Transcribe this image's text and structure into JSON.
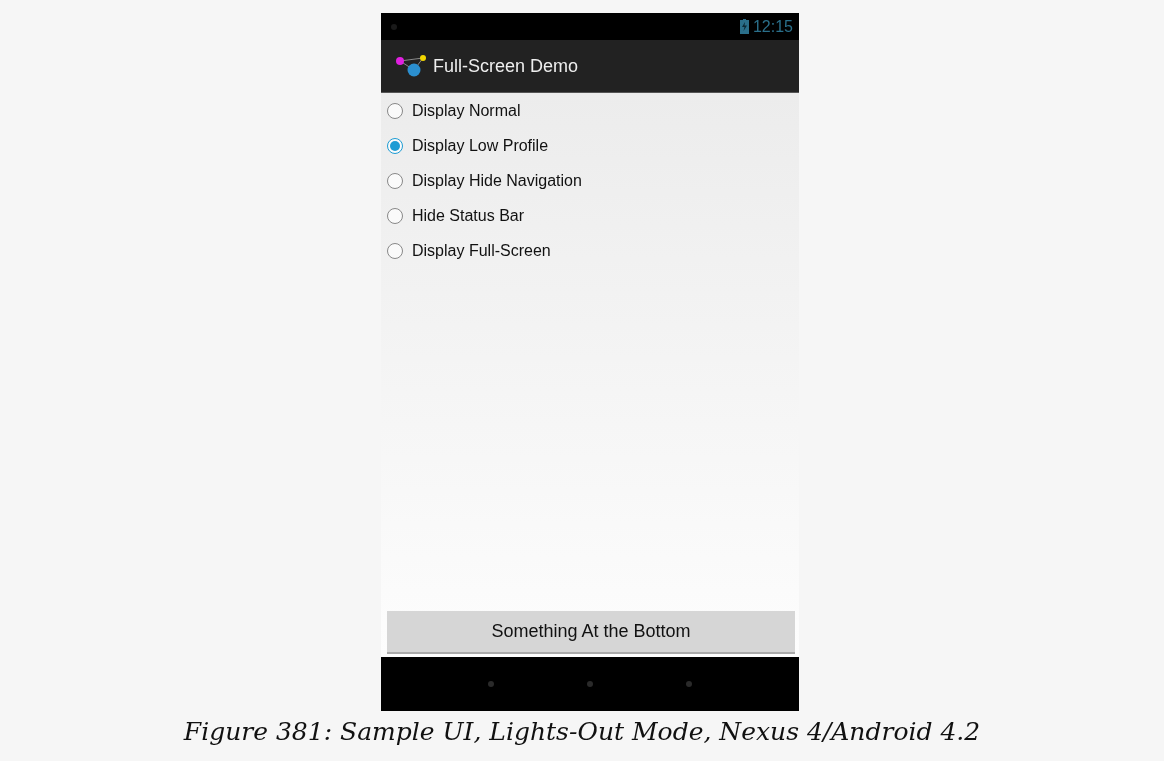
{
  "status_bar": {
    "time": "12:15"
  },
  "action_bar": {
    "title": "Full-Screen Demo"
  },
  "options": [
    {
      "label": "Display Normal",
      "selected": false
    },
    {
      "label": "Display Low Profile",
      "selected": true
    },
    {
      "label": "Display Hide Navigation",
      "selected": false
    },
    {
      "label": "Hide Status Bar",
      "selected": false
    },
    {
      "label": "Display Full-Screen",
      "selected": false
    }
  ],
  "bottom_button": {
    "label": "Something At the Bottom"
  },
  "caption": "Figure 381: Sample UI, Lights-Out Mode, Nexus 4/Android 4.2"
}
